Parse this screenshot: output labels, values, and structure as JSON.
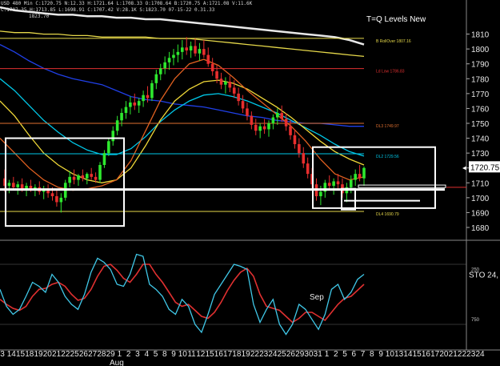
{
  "header": {
    "line1": "USD  480 Min  C:1720.75  N:12.33  H:1721.64  L:1708.33  O:1708.64  B:1720.75  A:1721.08  V:11.6K",
    "line2": "C:1707.35  H:1713.85  L:1698.91  C:1707.42  V:28.1K  S:1823.70  07-15-22  0.31.33",
    "line3": "1823.70"
  },
  "chart_data": {
    "type": "candlestick",
    "title": "T=Q Levels New",
    "price_axis": {
      "ylim": [
        1673,
        1820
      ],
      "ticks": [
        1680,
        1690,
        1700,
        1710,
        1720,
        1730,
        1740,
        1750,
        1760,
        1770,
        1780,
        1790,
        1800,
        1810
      ]
    },
    "last_price": "1720.75",
    "x_labels": [
      "3",
      "14",
      "15",
      "18",
      "19",
      "20",
      "21",
      "22",
      "25",
      "26",
      "27",
      "28",
      "29",
      "1",
      "2",
      "3",
      "4",
      "5",
      "8",
      "9",
      "10",
      "11",
      "12",
      "15",
      "16",
      "17",
      "18",
      "19",
      "22",
      "23",
      "24",
      "25",
      "26",
      "29",
      "30",
      "31",
      "1",
      "2",
      "5",
      "6",
      "7",
      "8",
      "9",
      "10",
      "13",
      "14",
      "15",
      "16",
      "17",
      "20",
      "21",
      "22",
      "23",
      "24"
    ],
    "months": [
      "Aug",
      "Sep"
    ],
    "candles": [
      [
        1713,
        1719,
        1704,
        1708
      ],
      [
        1708,
        1712,
        1703,
        1710
      ],
      [
        1710,
        1714,
        1705,
        1707
      ],
      [
        1707,
        1711,
        1702,
        1709
      ],
      [
        1709,
        1713,
        1704,
        1706
      ],
      [
        1706,
        1710,
        1701,
        1708
      ],
      [
        1708,
        1712,
        1704,
        1705
      ],
      [
        1705,
        1709,
        1701,
        1707
      ],
      [
        1707,
        1711,
        1702,
        1704
      ],
      [
        1704,
        1708,
        1699,
        1706
      ],
      [
        1706,
        1709,
        1700,
        1703
      ],
      [
        1703,
        1707,
        1698,
        1701
      ],
      [
        1701,
        1705,
        1694,
        1697
      ],
      [
        1697,
        1703,
        1690,
        1700
      ],
      [
        1700,
        1712,
        1698,
        1710
      ],
      [
        1710,
        1718,
        1707,
        1714
      ],
      [
        1714,
        1719,
        1709,
        1712
      ],
      [
        1712,
        1716,
        1708,
        1715
      ],
      [
        1715,
        1719,
        1711,
        1713
      ],
      [
        1713,
        1717,
        1709,
        1716
      ],
      [
        1716,
        1720,
        1712,
        1714
      ],
      [
        1714,
        1717,
        1710,
        1712
      ],
      [
        1712,
        1724,
        1710,
        1722
      ],
      [
        1722,
        1732,
        1720,
        1730
      ],
      [
        1730,
        1740,
        1728,
        1738
      ],
      [
        1738,
        1748,
        1735,
        1745
      ],
      [
        1745,
        1755,
        1742,
        1752
      ],
      [
        1752,
        1760,
        1748,
        1757
      ],
      [
        1757,
        1765,
        1753,
        1761
      ],
      [
        1761,
        1768,
        1756,
        1764
      ],
      [
        1764,
        1770,
        1759,
        1762
      ],
      [
        1762,
        1767,
        1757,
        1765
      ],
      [
        1765,
        1772,
        1761,
        1769
      ],
      [
        1769,
        1775,
        1764,
        1767
      ],
      [
        1767,
        1779,
        1765,
        1777
      ],
      [
        1777,
        1786,
        1773,
        1783
      ],
      [
        1783,
        1790,
        1779,
        1787
      ],
      [
        1787,
        1795,
        1783,
        1791
      ],
      [
        1791,
        1798,
        1786,
        1794
      ],
      [
        1794,
        1800,
        1789,
        1796
      ],
      [
        1796,
        1803,
        1791,
        1798
      ],
      [
        1798,
        1806,
        1793,
        1801
      ],
      [
        1801,
        1808,
        1796,
        1799
      ],
      [
        1799,
        1805,
        1794,
        1802
      ],
      [
        1802,
        1807,
        1795,
        1797
      ],
      [
        1797,
        1804,
        1792,
        1800
      ],
      [
        1800,
        1806,
        1794,
        1796
      ],
      [
        1796,
        1801,
        1788,
        1790
      ],
      [
        1790,
        1794,
        1782,
        1785
      ],
      [
        1785,
        1789,
        1777,
        1780
      ],
      [
        1780,
        1784,
        1773,
        1776
      ],
      [
        1776,
        1781,
        1770,
        1778
      ],
      [
        1778,
        1782,
        1771,
        1774
      ],
      [
        1774,
        1779,
        1767,
        1770
      ],
      [
        1770,
        1774,
        1762,
        1765
      ],
      [
        1765,
        1769,
        1757,
        1760
      ],
      [
        1760,
        1764,
        1752,
        1755
      ],
      [
        1755,
        1758,
        1746,
        1749
      ],
      [
        1749,
        1753,
        1742,
        1745
      ],
      [
        1745,
        1750,
        1740,
        1748
      ],
      [
        1748,
        1753,
        1743,
        1746
      ],
      [
        1746,
        1752,
        1741,
        1750
      ],
      [
        1750,
        1756,
        1746,
        1754
      ],
      [
        1754,
        1760,
        1749,
        1757
      ],
      [
        1757,
        1762,
        1751,
        1753
      ],
      [
        1753,
        1757,
        1745,
        1748
      ],
      [
        1748,
        1752,
        1739,
        1742
      ],
      [
        1742,
        1746,
        1733,
        1736
      ],
      [
        1736,
        1740,
        1727,
        1730
      ],
      [
        1730,
        1734,
        1720,
        1723
      ],
      [
        1723,
        1727,
        1713,
        1716
      ],
      [
        1716,
        1720,
        1706,
        1709
      ],
      [
        1709,
        1713,
        1698,
        1701
      ],
      [
        1701,
        1708,
        1695,
        1704
      ],
      [
        1704,
        1712,
        1700,
        1710
      ],
      [
        1710,
        1715,
        1705,
        1708
      ],
      [
        1708,
        1713,
        1702,
        1711
      ],
      [
        1711,
        1716,
        1706,
        1709
      ],
      [
        1709,
        1713,
        1700,
        1703
      ],
      [
        1703,
        1710,
        1697,
        1707
      ],
      [
        1707,
        1715,
        1703,
        1712
      ],
      [
        1712,
        1719,
        1708,
        1716
      ],
      [
        1716,
        1722,
        1711,
        1713
      ],
      [
        1713,
        1721,
        1708,
        1720
      ]
    ],
    "moving_averages": [
      {
        "color": "#e8e8e8",
        "values": [
          1828,
          1826,
          1825,
          1824,
          1823,
          1823,
          1822,
          1822,
          1821,
          1821,
          1820,
          1820,
          1819,
          1818,
          1817,
          1816,
          1815,
          1814,
          1813,
          1812,
          1811,
          1810,
          1809,
          1808,
          1806,
          1803
        ]
      },
      {
        "color": "#e6d84a",
        "values": [
          1812,
          1811,
          1811,
          1810,
          1810,
          1809,
          1809,
          1808,
          1808,
          1808,
          1808,
          1807,
          1807,
          1807,
          1806,
          1805,
          1804,
          1803,
          1802,
          1801,
          1800,
          1799,
          1798,
          1797,
          1796,
          1795
        ]
      },
      {
        "color": "#2040e8",
        "values": [
          1803,
          1798,
          1792,
          1787,
          1783,
          1780,
          1778,
          1776,
          1772,
          1768,
          1766,
          1765,
          1763,
          1762,
          1761,
          1759,
          1757,
          1755,
          1754,
          1752,
          1751,
          1750,
          1750,
          1749,
          1748,
          1748
        ]
      },
      {
        "color": "#00c8e8",
        "values": [
          1780,
          1772,
          1762,
          1752,
          1744,
          1737,
          1732,
          1729,
          1729,
          1733,
          1741,
          1751,
          1759,
          1765,
          1769,
          1770,
          1768,
          1765,
          1761,
          1757,
          1752,
          1747,
          1742,
          1736,
          1731,
          1728
        ]
      },
      {
        "color": "#f0d838",
        "values": [
          1765,
          1755,
          1742,
          1730,
          1722,
          1716,
          1712,
          1710,
          1712,
          1720,
          1735,
          1752,
          1765,
          1773,
          1778,
          1779,
          1777,
          1773,
          1767,
          1761,
          1754,
          1746,
          1738,
          1731,
          1726,
          1722
        ]
      },
      {
        "color": "#e06020",
        "values": [
          1740,
          1730,
          1720,
          1712,
          1707,
          1705,
          1706,
          1708,
          1712,
          1725,
          1745,
          1765,
          1780,
          1790,
          1793,
          1789,
          1781,
          1772,
          1764,
          1756,
          1748,
          1738,
          1726,
          1716,
          1712,
          1714
        ]
      }
    ],
    "levels": [
      {
        "price": 1807.16,
        "label": "B RollOver 1807.16",
        "color": "#e6d84a"
      },
      {
        "price": 1786.83,
        "label": "Ld Low 1786.83",
        "color": "#e03030"
      },
      {
        "price": 1749.97,
        "label": "DL3 1749.97",
        "color": "#e07030"
      },
      {
        "price": 1729.56,
        "label": "DL2 1729.56",
        "color": "#00c8e8"
      },
      {
        "price": 1690.79,
        "label": "DL4 1690.79",
        "color": "#e6d84a"
      }
    ],
    "stochastic": {
      "label": "STO  24,",
      "ticks": [
        "250",
        "750"
      ],
      "k_color": "#40c8e8",
      "d_color": "#e03030",
      "k": [
        55,
        38,
        30,
        35,
        48,
        62,
        58,
        52,
        70,
        62,
        48,
        40,
        35,
        50,
        72,
        86,
        82,
        75,
        60,
        58,
        70,
        90,
        88,
        60,
        55,
        48,
        35,
        30,
        45,
        38,
        20,
        12,
        30,
        50,
        60,
        70,
        80,
        78,
        75,
        40,
        22,
        35,
        45,
        20,
        10,
        20,
        40,
        35,
        25,
        15,
        30,
        55,
        60,
        45,
        52,
        65,
        70
      ],
      "d": [
        45,
        40,
        36,
        34,
        38,
        48,
        55,
        56,
        60,
        62,
        58,
        50,
        44,
        46,
        55,
        68,
        78,
        80,
        74,
        66,
        62,
        70,
        80,
        80,
        70,
        62,
        52,
        42,
        38,
        40,
        34,
        28,
        26,
        32,
        42,
        54,
        64,
        72,
        76,
        68,
        50,
        38,
        36,
        34,
        28,
        22,
        26,
        32,
        32,
        28,
        24,
        32,
        40,
        46,
        48,
        54,
        60
      ]
    }
  }
}
